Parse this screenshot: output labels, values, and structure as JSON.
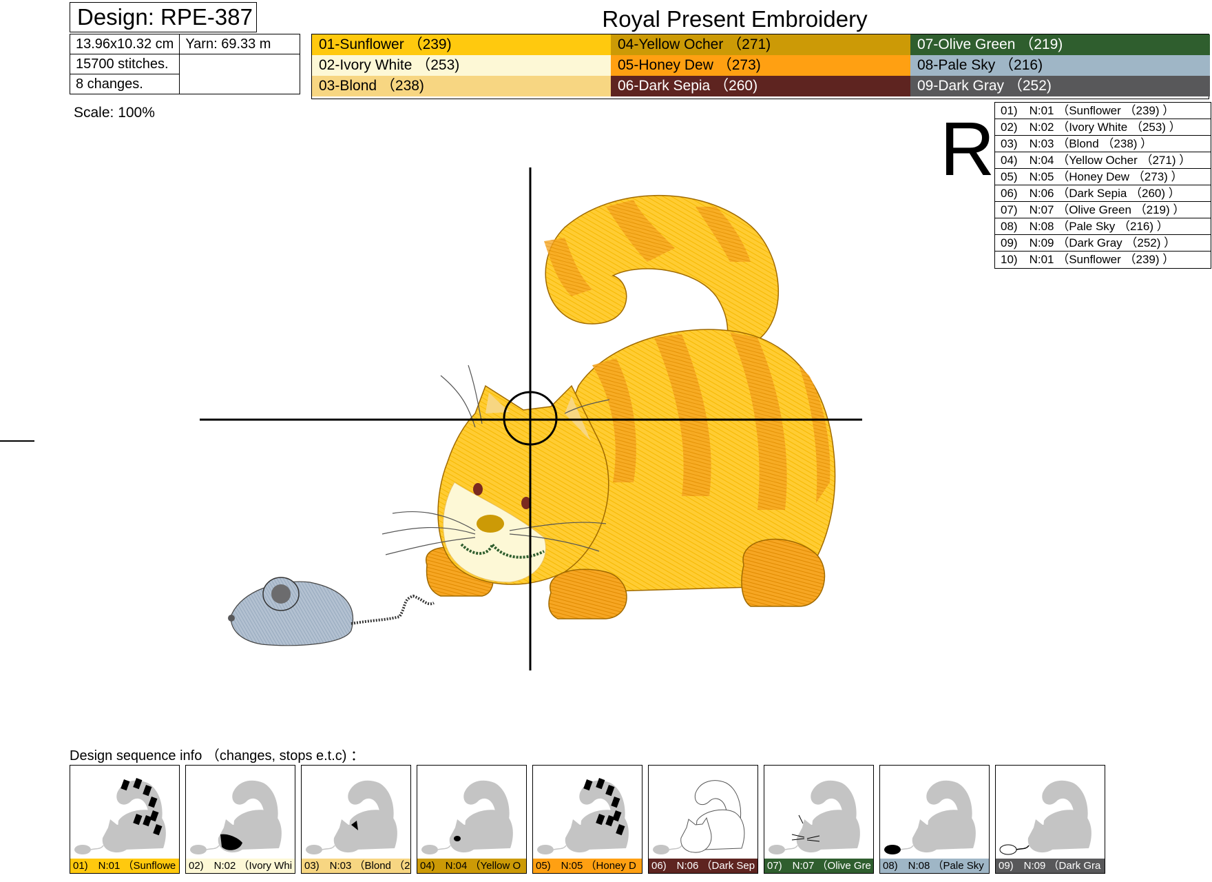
{
  "header": {
    "design": "Design: RPE-387",
    "brand": "Royal Present Embroidery"
  },
  "info": {
    "size": "13.96x10.32 cm",
    "yarn": "Yarn: 69.33 m",
    "stitches": "15700 stitches.",
    "changes": "8 changes."
  },
  "palette": [
    {
      "label": "01-Sunflower （239)",
      "color": "#ffc90e",
      "dark": false
    },
    {
      "label": "02-Ivory White （253)",
      "color": "#fdf8d6",
      "dark": false
    },
    {
      "label": "03-Blond （238)",
      "color": "#f7d682",
      "dark": false
    },
    {
      "label": "04-Yellow Ocher （271)",
      "color": "#cc9a06",
      "dark": false
    },
    {
      "label": "05-Honey Dew （273)",
      "color": "#ffa012",
      "dark": false
    },
    {
      "label": "06-Dark Sepia （260)",
      "color": "#5e2420",
      "dark": true
    },
    {
      "label": "07-Olive Green （219)",
      "color": "#2f5e2e",
      "dark": true
    },
    {
      "label": "08-Pale Sky （216)",
      "color": "#9fb6c6",
      "dark": false
    },
    {
      "label": "09-Dark Gray （252)",
      "color": "#58585a",
      "dark": true
    }
  ],
  "scale": "Scale: 100%",
  "r_letter": "R",
  "sequence": [
    "01)　N:01 （Sunflower （239) ）",
    "02)　N:02 （Ivory White （253) ）",
    "03)　N:03 （Blond （238) ）",
    "04)　N:04 （Yellow Ocher （271) ）",
    "05)　N:05 （Honey Dew （273) ）",
    "06)　N:06 （Dark Sepia （260) ）",
    "07)　N:07 （Olive Green （219) ）",
    "08)　N:08 （Pale Sky （216) ）",
    "09)　N:09 （Dark Gray （252) ）",
    "10)　N:01 （Sunflower （239) ）"
  ],
  "sequence_title": "Design sequence info （changes, stops e.t.c) ：",
  "thumbnails": [
    {
      "label": "01)　N:01 （Sunflowe",
      "color": "#ffc90e",
      "dark": false,
      "highlight": "stripes"
    },
    {
      "label": "02)　N:02 （Ivory Whi",
      "color": "#fdf8d6",
      "dark": false,
      "highlight": "face"
    },
    {
      "label": "03)　N:03 （Blond （2",
      "color": "#f7d682",
      "dark": false,
      "highlight": "ear"
    },
    {
      "label": "04)　N:04 （Yellow O",
      "color": "#cc9a06",
      "dark": false,
      "highlight": "nose"
    },
    {
      "label": "05)　N:05 （Honey D",
      "color": "#ffa012",
      "dark": false,
      "highlight": "stripes2"
    },
    {
      "label": "06)　N:06 （Dark Sep",
      "color": "#5e2420",
      "dark": true,
      "highlight": "outline"
    },
    {
      "label": "07)　N:07 （Olive Gre",
      "color": "#2f5e2e",
      "dark": true,
      "highlight": "whiskers"
    },
    {
      "label": "08)　N:08 （Pale Sky",
      "color": "#9fb6c6",
      "dark": false,
      "highlight": "mouse"
    },
    {
      "label": "09)　N:09 （Dark Gra",
      "color": "#58585a",
      "dark": true,
      "highlight": "mouse-outline"
    }
  ]
}
